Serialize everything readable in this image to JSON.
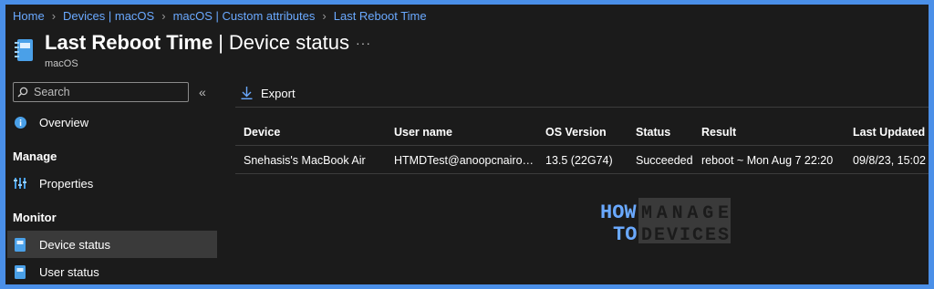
{
  "breadcrumb": [
    "Home",
    "Devices | macOS",
    "macOS | Custom attributes",
    "Last Reboot Time"
  ],
  "header": {
    "title": "Last Reboot Time",
    "separator": "|",
    "subtitle_inline": "Device status",
    "more": "···",
    "subtitle": "macOS"
  },
  "sidebar": {
    "search_placeholder": "Search",
    "collapse": "«",
    "overview": "Overview",
    "manage_heading": "Manage",
    "properties": "Properties",
    "monitor_heading": "Monitor",
    "device_status": "Device status",
    "user_status": "User status"
  },
  "toolbar": {
    "export_label": "Export"
  },
  "table": {
    "columns": [
      "Device",
      "User name",
      "OS Version",
      "Status",
      "Result",
      "Last Updated"
    ],
    "rows": [
      {
        "device": "Snehasis's MacBook Air",
        "user": "HTMDTest@anoopcnairoutl...",
        "os": "13.5 (22G74)",
        "status": "Succeeded",
        "result": "reboot ~ Mon Aug 7 22:20",
        "updated": "09/8/23, 15:02"
      }
    ]
  },
  "watermark": {
    "line1_left": "HOW",
    "line2_left": "TO",
    "line1_right": "MANAGE",
    "line2_right": "DEVICES"
  },
  "colors": {
    "frame_border": "#4a8fe8",
    "background": "#1b1b1b",
    "link": "#6aa9ff",
    "active_nav": "#3a3a3a",
    "icon_blue": "#4aa0e8"
  }
}
